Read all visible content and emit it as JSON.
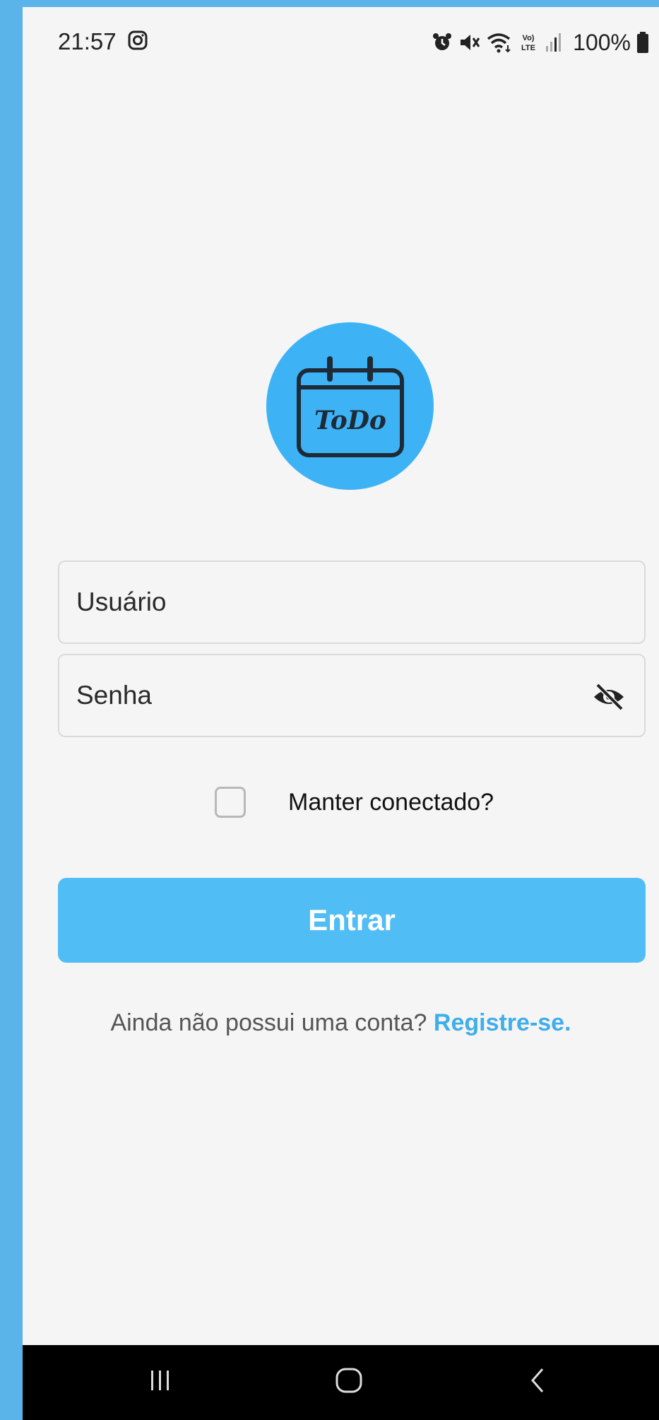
{
  "status_bar": {
    "time": "21:57",
    "battery": "100%",
    "icons": [
      "instagram-icon",
      "alarm-icon",
      "mute-icon",
      "wifi-icon",
      "volte-icon",
      "signal-icon",
      "battery-icon"
    ]
  },
  "logo": {
    "text": "ToDo",
    "icon": "calendar-icon",
    "color": "#3DB3F6"
  },
  "form": {
    "username_placeholder": "Usuário",
    "password_placeholder": "Senha",
    "password_toggle_icon": "eye-off-icon",
    "remember_label": "Manter conectado?",
    "remember_checked": false,
    "submit_label": "Entrar"
  },
  "register": {
    "prompt": "Ainda não possui uma conta?",
    "link": "Registre-se."
  },
  "colors": {
    "accent": "#50BDF5",
    "link": "#3FAEEA",
    "frame": "#5AB4EA"
  },
  "nav_bar": {
    "icons": [
      "recents-icon",
      "home-icon",
      "back-icon"
    ]
  }
}
